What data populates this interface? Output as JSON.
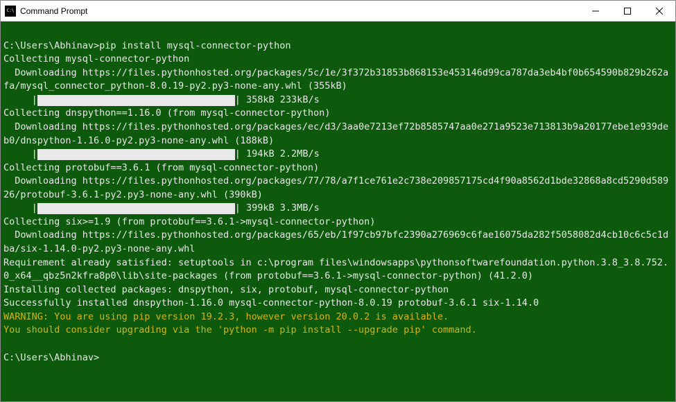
{
  "window": {
    "title": "Command Prompt"
  },
  "term": {
    "prompt1": "C:\\Users\\Abhinav>",
    "cmd1": "pip install mysql-connector-python",
    "collecting1": "Collecting mysql-connector-python",
    "download1": "  Downloading https://files.pythonhosted.org/packages/5c/1e/3f372b31853b868153e453146d99ca787da3eb4bf0b654590b829b262afa/mysql_connector_python-8.0.19-py2.py3-none-any.whl (355kB)",
    "progress1_pre": "     |",
    "progress1_after": "| 358kB 233kB/s",
    "collecting2": "Collecting dnspython==1.16.0 (from mysql-connector-python)",
    "download2": "  Downloading https://files.pythonhosted.org/packages/ec/d3/3aa0e7213ef72b8585747aa0e271a9523e713813b9a20177ebe1e939deb0/dnspython-1.16.0-py2.py3-none-any.whl (188kB)",
    "progress2_pre": "     |",
    "progress2_after": "| 194kB 2.2MB/s",
    "collecting3": "Collecting protobuf==3.6.1 (from mysql-connector-python)",
    "download3": "  Downloading https://files.pythonhosted.org/packages/77/78/a7f1ce761e2c738e209857175cd4f90a8562d1bde32868a8cd5290d58926/protobuf-3.6.1-py2.py3-none-any.whl (390kB)",
    "progress3_pre": "     |",
    "progress3_after": "| 399kB 3.3MB/s",
    "collecting4": "Collecting six>=1.9 (from protobuf==3.6.1->mysql-connector-python)",
    "download4": "  Downloading https://files.pythonhosted.org/packages/65/eb/1f97cb97bfc2390a276969c6fae16075da282f5058082d4cb10c6c5c1dba/six-1.14.0-py2.py3-none-any.whl",
    "req_satisfied": "Requirement already satisfied: setuptools in c:\\program files\\windowsapps\\pythonsoftwarefoundation.python.3.8_3.8.752.0_x64__qbz5n2kfra8p0\\lib\\site-packages (from protobuf==3.6.1->mysql-connector-python) (41.2.0)",
    "installing": "Installing collected packages: dnspython, six, protobuf, mysql-connector-python",
    "success": "Successfully installed dnspython-1.16.0 mysql-connector-python-8.0.19 protobuf-3.6.1 six-1.14.0",
    "warning1": "WARNING: You are using pip version 19.2.3, however version 20.0.2 is available.",
    "warning2": "You should consider upgrading via the 'python -m pip install --upgrade pip' command.",
    "prompt2": "C:\\Users\\Abhinav>",
    "progress_bar_width": 285
  }
}
